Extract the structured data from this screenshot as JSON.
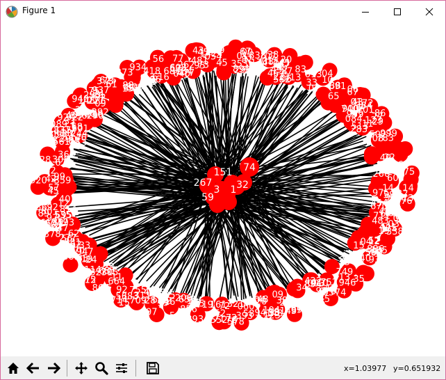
{
  "window": {
    "title": "Figure 1",
    "controls": [
      "minimize",
      "maximize",
      "close"
    ]
  },
  "figure": {
    "description_marks": "network graph: red circular nodes with white numeric labels arranged on an outer ellipse, black edges converging to a small central cluster",
    "node_color": "#ff0000",
    "edge_color": "#000000",
    "label_color": "#ffffff",
    "visible_labels": [
      "151",
      "74",
      "267",
      "59",
      "32",
      "1",
      "3"
    ]
  },
  "toolbar": {
    "icons": [
      "home-icon",
      "back-arrow-icon",
      "forward-arrow-icon",
      "pan-icon",
      "zoom-icon",
      "configure-subplots-icon",
      "save-icon"
    ]
  },
  "status": {
    "x_readout": "x=1.03977",
    "y_readout": "y=0.651932"
  }
}
